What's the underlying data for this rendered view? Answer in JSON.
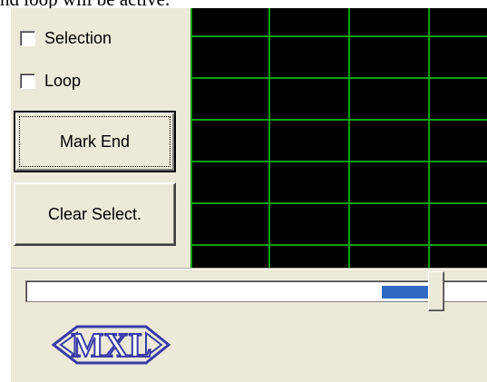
{
  "caption": "nd loop will be active.",
  "controls": {
    "selection_label": "Selection",
    "loop_label": "Loop",
    "mark_end_label": "Mark End",
    "clear_select_label": "Clear Select."
  },
  "display": {
    "background": "#000000",
    "grid_color": "#00a000"
  },
  "position_slider": {
    "value_fraction": 0.89,
    "selection_fraction": [
      0.77,
      0.87
    ],
    "selection_color": "#316ac5"
  },
  "logo": {
    "text": "MXL",
    "color": "#3a3aa8"
  }
}
